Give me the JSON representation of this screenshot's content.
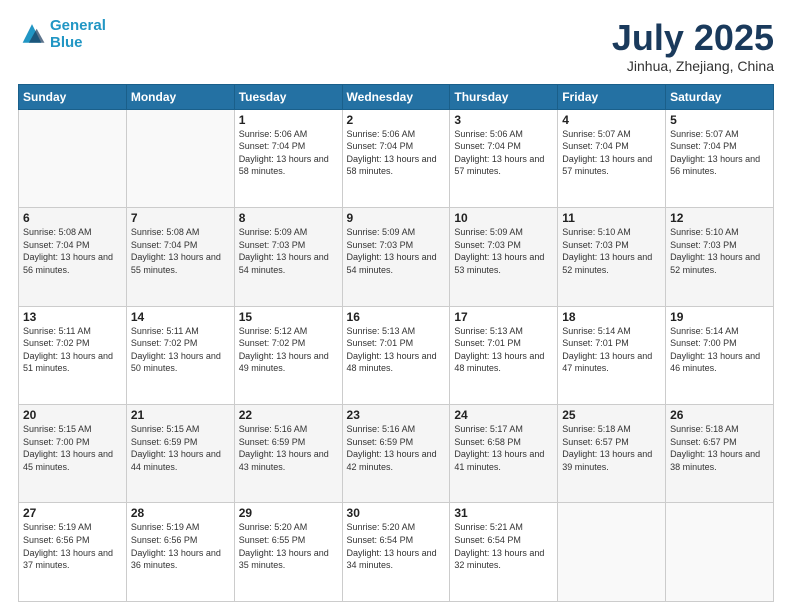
{
  "header": {
    "logo_line1": "General",
    "logo_line2": "Blue",
    "month": "July 2025",
    "location": "Jinhua, Zhejiang, China"
  },
  "weekdays": [
    "Sunday",
    "Monday",
    "Tuesday",
    "Wednesday",
    "Thursday",
    "Friday",
    "Saturday"
  ],
  "weeks": [
    [
      {
        "day": "",
        "info": ""
      },
      {
        "day": "",
        "info": ""
      },
      {
        "day": "1",
        "info": "Sunrise: 5:06 AM\nSunset: 7:04 PM\nDaylight: 13 hours and 58 minutes."
      },
      {
        "day": "2",
        "info": "Sunrise: 5:06 AM\nSunset: 7:04 PM\nDaylight: 13 hours and 58 minutes."
      },
      {
        "day": "3",
        "info": "Sunrise: 5:06 AM\nSunset: 7:04 PM\nDaylight: 13 hours and 57 minutes."
      },
      {
        "day": "4",
        "info": "Sunrise: 5:07 AM\nSunset: 7:04 PM\nDaylight: 13 hours and 57 minutes."
      },
      {
        "day": "5",
        "info": "Sunrise: 5:07 AM\nSunset: 7:04 PM\nDaylight: 13 hours and 56 minutes."
      }
    ],
    [
      {
        "day": "6",
        "info": "Sunrise: 5:08 AM\nSunset: 7:04 PM\nDaylight: 13 hours and 56 minutes."
      },
      {
        "day": "7",
        "info": "Sunrise: 5:08 AM\nSunset: 7:04 PM\nDaylight: 13 hours and 55 minutes."
      },
      {
        "day": "8",
        "info": "Sunrise: 5:09 AM\nSunset: 7:03 PM\nDaylight: 13 hours and 54 minutes."
      },
      {
        "day": "9",
        "info": "Sunrise: 5:09 AM\nSunset: 7:03 PM\nDaylight: 13 hours and 54 minutes."
      },
      {
        "day": "10",
        "info": "Sunrise: 5:09 AM\nSunset: 7:03 PM\nDaylight: 13 hours and 53 minutes."
      },
      {
        "day": "11",
        "info": "Sunrise: 5:10 AM\nSunset: 7:03 PM\nDaylight: 13 hours and 52 minutes."
      },
      {
        "day": "12",
        "info": "Sunrise: 5:10 AM\nSunset: 7:03 PM\nDaylight: 13 hours and 52 minutes."
      }
    ],
    [
      {
        "day": "13",
        "info": "Sunrise: 5:11 AM\nSunset: 7:02 PM\nDaylight: 13 hours and 51 minutes."
      },
      {
        "day": "14",
        "info": "Sunrise: 5:11 AM\nSunset: 7:02 PM\nDaylight: 13 hours and 50 minutes."
      },
      {
        "day": "15",
        "info": "Sunrise: 5:12 AM\nSunset: 7:02 PM\nDaylight: 13 hours and 49 minutes."
      },
      {
        "day": "16",
        "info": "Sunrise: 5:13 AM\nSunset: 7:01 PM\nDaylight: 13 hours and 48 minutes."
      },
      {
        "day": "17",
        "info": "Sunrise: 5:13 AM\nSunset: 7:01 PM\nDaylight: 13 hours and 48 minutes."
      },
      {
        "day": "18",
        "info": "Sunrise: 5:14 AM\nSunset: 7:01 PM\nDaylight: 13 hours and 47 minutes."
      },
      {
        "day": "19",
        "info": "Sunrise: 5:14 AM\nSunset: 7:00 PM\nDaylight: 13 hours and 46 minutes."
      }
    ],
    [
      {
        "day": "20",
        "info": "Sunrise: 5:15 AM\nSunset: 7:00 PM\nDaylight: 13 hours and 45 minutes."
      },
      {
        "day": "21",
        "info": "Sunrise: 5:15 AM\nSunset: 6:59 PM\nDaylight: 13 hours and 44 minutes."
      },
      {
        "day": "22",
        "info": "Sunrise: 5:16 AM\nSunset: 6:59 PM\nDaylight: 13 hours and 43 minutes."
      },
      {
        "day": "23",
        "info": "Sunrise: 5:16 AM\nSunset: 6:59 PM\nDaylight: 13 hours and 42 minutes."
      },
      {
        "day": "24",
        "info": "Sunrise: 5:17 AM\nSunset: 6:58 PM\nDaylight: 13 hours and 41 minutes."
      },
      {
        "day": "25",
        "info": "Sunrise: 5:18 AM\nSunset: 6:57 PM\nDaylight: 13 hours and 39 minutes."
      },
      {
        "day": "26",
        "info": "Sunrise: 5:18 AM\nSunset: 6:57 PM\nDaylight: 13 hours and 38 minutes."
      }
    ],
    [
      {
        "day": "27",
        "info": "Sunrise: 5:19 AM\nSunset: 6:56 PM\nDaylight: 13 hours and 37 minutes."
      },
      {
        "day": "28",
        "info": "Sunrise: 5:19 AM\nSunset: 6:56 PM\nDaylight: 13 hours and 36 minutes."
      },
      {
        "day": "29",
        "info": "Sunrise: 5:20 AM\nSunset: 6:55 PM\nDaylight: 13 hours and 35 minutes."
      },
      {
        "day": "30",
        "info": "Sunrise: 5:20 AM\nSunset: 6:54 PM\nDaylight: 13 hours and 34 minutes."
      },
      {
        "day": "31",
        "info": "Sunrise: 5:21 AM\nSunset: 6:54 PM\nDaylight: 13 hours and 32 minutes."
      },
      {
        "day": "",
        "info": ""
      },
      {
        "day": "",
        "info": ""
      }
    ]
  ]
}
